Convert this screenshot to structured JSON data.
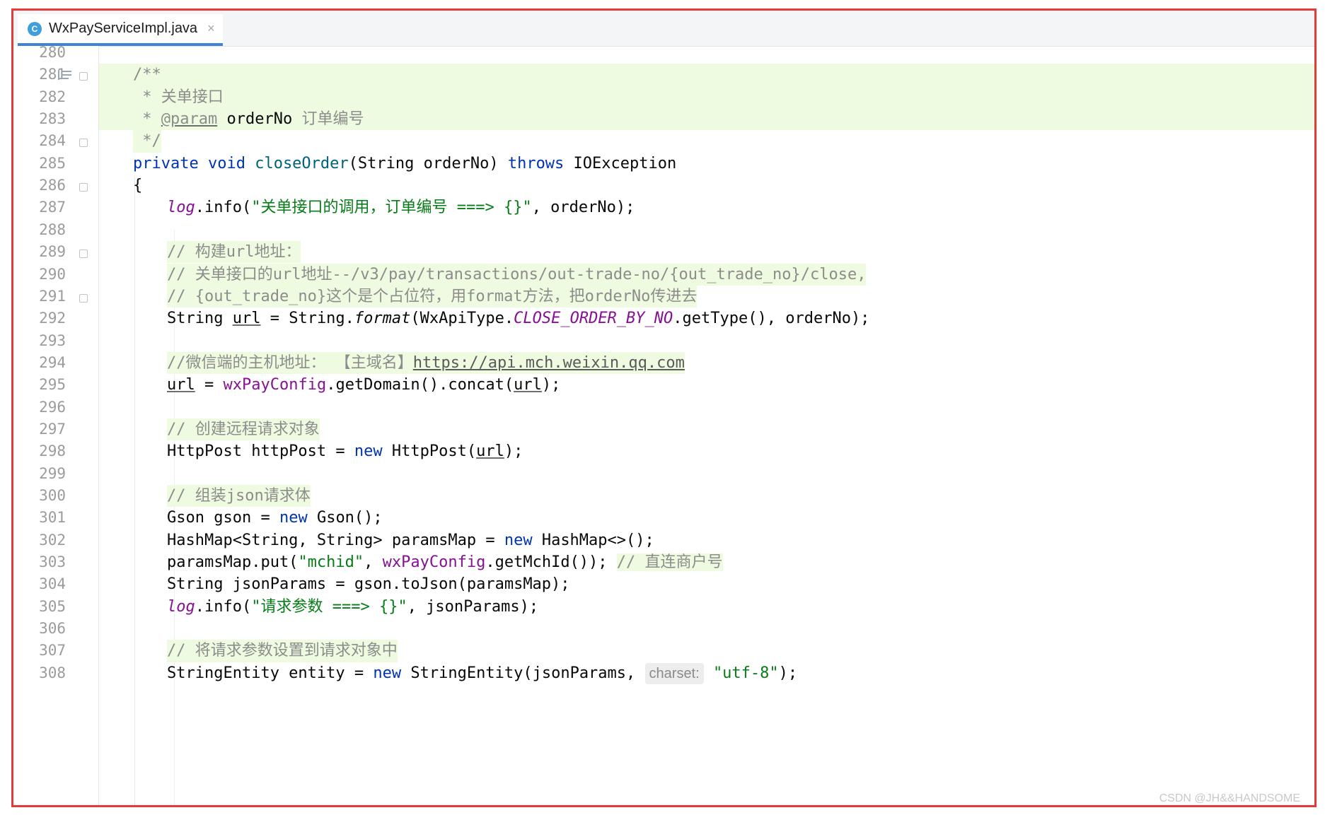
{
  "tab": {
    "icon_letter": "C",
    "filename": "WxPayServiceImpl.java",
    "close_glyph": "×"
  },
  "lines": [
    {
      "n": "280",
      "html": ""
    },
    {
      "n": "281",
      "html": "/**"
    },
    {
      "n": "282",
      "html": " * 关单接口"
    },
    {
      "n": "283",
      "html": " * @param orderNo 订单编号"
    },
    {
      "n": "284",
      "html": " */"
    },
    {
      "n": "285",
      "html": "private void closeOrder(String orderNo) throws IOException"
    },
    {
      "n": "286",
      "html": "{"
    },
    {
      "n": "287",
      "html": "log.info(\"关单接口的调用，订单编号 ===> {}\", orderNo);"
    },
    {
      "n": "288",
      "html": ""
    },
    {
      "n": "289",
      "html": "// 构建url地址："
    },
    {
      "n": "290",
      "html": "// 关单接口的url地址--/v3/pay/transactions/out-trade-no/{out_trade_no}/close,"
    },
    {
      "n": "291",
      "html": "// {out_trade_no}这个是个占位符，用format方法，把orderNo传进去"
    },
    {
      "n": "292",
      "html": "String url = String.format(WxApiType.CLOSE_ORDER_BY_NO.getType(), orderNo);"
    },
    {
      "n": "293",
      "html": ""
    },
    {
      "n": "294",
      "html": "//微信端的主机地址： 【主域名】https://api.mch.weixin.qq.com"
    },
    {
      "n": "295",
      "html": "url = wxPayConfig.getDomain().concat(url);"
    },
    {
      "n": "296",
      "html": ""
    },
    {
      "n": "297",
      "html": "// 创建远程请求对象"
    },
    {
      "n": "298",
      "html": "HttpPost httpPost = new HttpPost(url);"
    },
    {
      "n": "299",
      "html": ""
    },
    {
      "n": "300",
      "html": "// 组装json请求体"
    },
    {
      "n": "301",
      "html": "Gson gson = new Gson();"
    },
    {
      "n": "302",
      "html": "HashMap<String, String> paramsMap = new HashMap<>();"
    },
    {
      "n": "303",
      "html": "paramsMap.put(\"mchid\", wxPayConfig.getMchId()); // 直连商户号"
    },
    {
      "n": "304",
      "html": "String jsonParams = gson.toJson(paramsMap);"
    },
    {
      "n": "305",
      "html": "log.info(\"请求参数 ===> {}\", jsonParams);"
    },
    {
      "n": "306",
      "html": ""
    },
    {
      "n": "307",
      "html": "// 将请求参数设置到请求对象中"
    },
    {
      "n": "308",
      "html": "StringEntity entity = new StringEntity(jsonParams, charset: \"utf-8\");"
    }
  ],
  "watermark": "CSDN @JH&&HANDSOME"
}
